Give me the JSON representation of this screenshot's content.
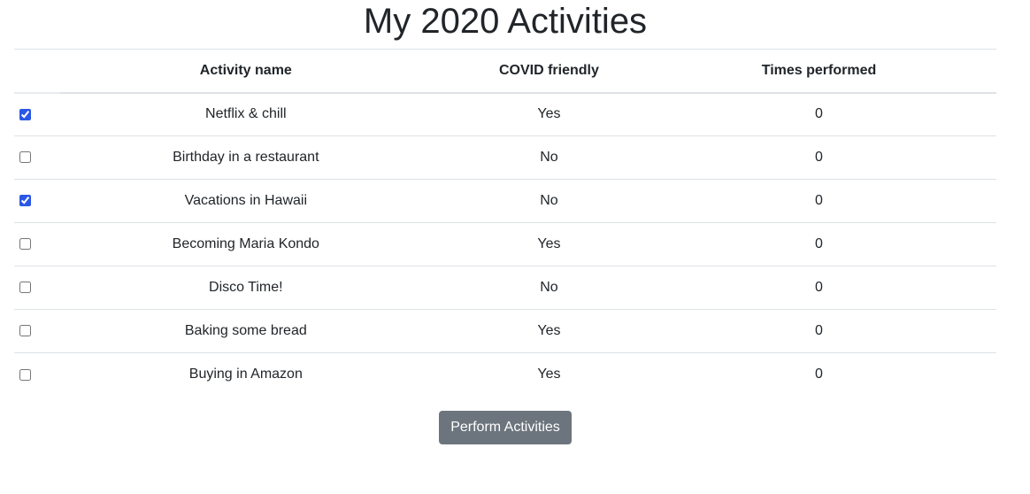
{
  "page": {
    "title": "My 2020 Activities"
  },
  "table": {
    "headers": {
      "select": "",
      "name": "Activity name",
      "covid": "COVID friendly",
      "times": "Times performed"
    },
    "rows": [
      {
        "checked": true,
        "name": "Netflix & chill",
        "covid": "Yes",
        "times": "0"
      },
      {
        "checked": false,
        "name": "Birthday in a restaurant",
        "covid": "No",
        "times": "0"
      },
      {
        "checked": true,
        "name": "Vacations in Hawaii",
        "covid": "No",
        "times": "0"
      },
      {
        "checked": false,
        "name": "Becoming Maria Kondo",
        "covid": "Yes",
        "times": "0"
      },
      {
        "checked": false,
        "name": "Disco Time!",
        "covid": "No",
        "times": "0"
      },
      {
        "checked": false,
        "name": "Baking some bread",
        "covid": "Yes",
        "times": "0"
      },
      {
        "checked": false,
        "name": "Buying in Amazon",
        "covid": "Yes",
        "times": "0"
      }
    ]
  },
  "actions": {
    "perform_label": "Perform Activities"
  },
  "colors": {
    "button_bg": "#6c757d",
    "checkbox_accent": "#2b57e6",
    "border": "#dee2e6",
    "text": "#212529"
  }
}
